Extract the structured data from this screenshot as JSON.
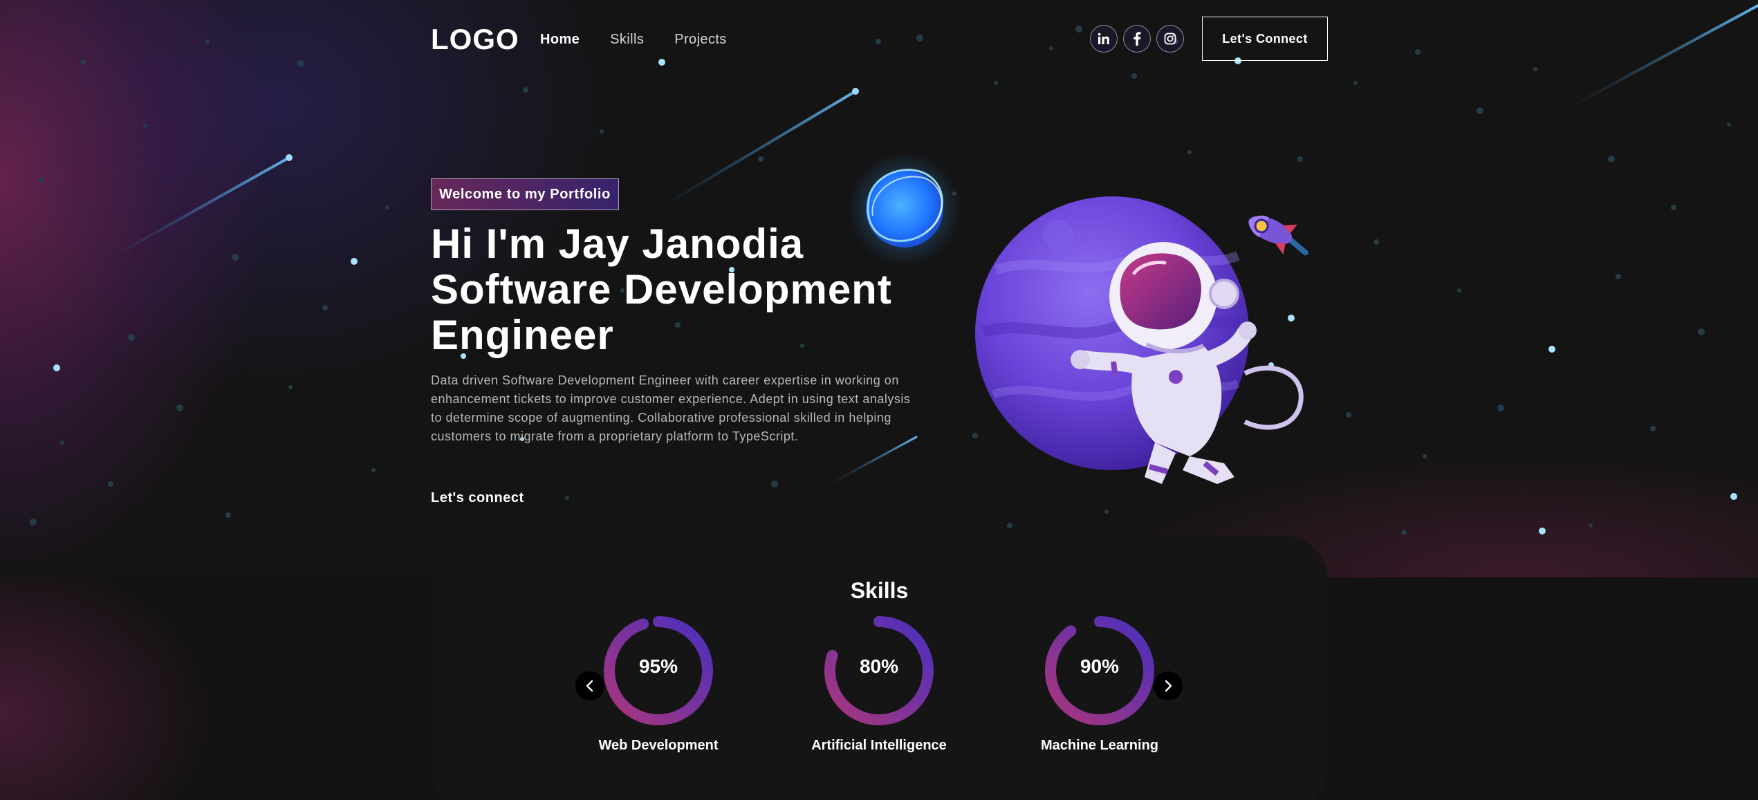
{
  "navbar": {
    "logo": "LOGO",
    "links": [
      {
        "label": "Home",
        "active": true
      },
      {
        "label": "Skills",
        "active": false
      },
      {
        "label": "Projects",
        "active": false
      }
    ],
    "social": [
      {
        "name": "linkedin",
        "icon": "linkedin-icon",
        "glyph": "in"
      },
      {
        "name": "facebook",
        "icon": "facebook-icon",
        "glyph": "f"
      },
      {
        "name": "instagram",
        "icon": "instagram-icon",
        "glyph": ""
      }
    ],
    "connect_button": "Let's Connect"
  },
  "hero": {
    "tagline": "Welcome to my Portfolio",
    "title_lines": [
      "Hi I'm Jay Janodia",
      "Software Development",
      "Engineer"
    ],
    "description": "Data driven Software Development Engineer with career expertise in working on enhancement tickets to improve customer experience. Adept in using text analysis to determine scope of augmenting. Collaborative professional skilled in helping customers to migrate from a proprietary platform to TypeScript.",
    "cta": "Let's connect"
  },
  "skills": {
    "heading": "Skills",
    "items": [
      {
        "label": "Web Development",
        "value_text": "95%",
        "percent": 95
      },
      {
        "label": "Artificial Intelligence",
        "value_text": "80%",
        "percent": 80
      },
      {
        "label": "Machine Learning",
        "value_text": "90%",
        "percent": 90
      }
    ],
    "prev_icon": "chevron-left-icon",
    "next_icon": "chevron-right-icon"
  },
  "colors": {
    "background": "#121212",
    "gradient_start": "#AA367C",
    "gradient_end": "#4A2FBD",
    "skills_panel": "#151515",
    "text_muted": "#B8B8B8"
  }
}
